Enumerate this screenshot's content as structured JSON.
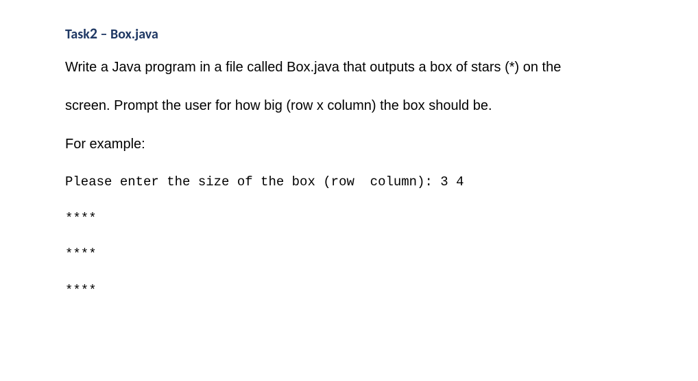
{
  "heading": {
    "task_prefix": "Task",
    "task_number": "2",
    "task_suffix": " – Box.java"
  },
  "paragraphs": {
    "p1": "Write a Java program in a file called Box.java that outputs a box of stars (*) on the",
    "p2": "screen. Prompt the user for how big (row x column) the box should be.",
    "p3": "For example:"
  },
  "code": {
    "prompt_line": "Please enter the size of the box (row  column): 3 4",
    "row1": "****",
    "row2": "****",
    "row3": "****"
  }
}
